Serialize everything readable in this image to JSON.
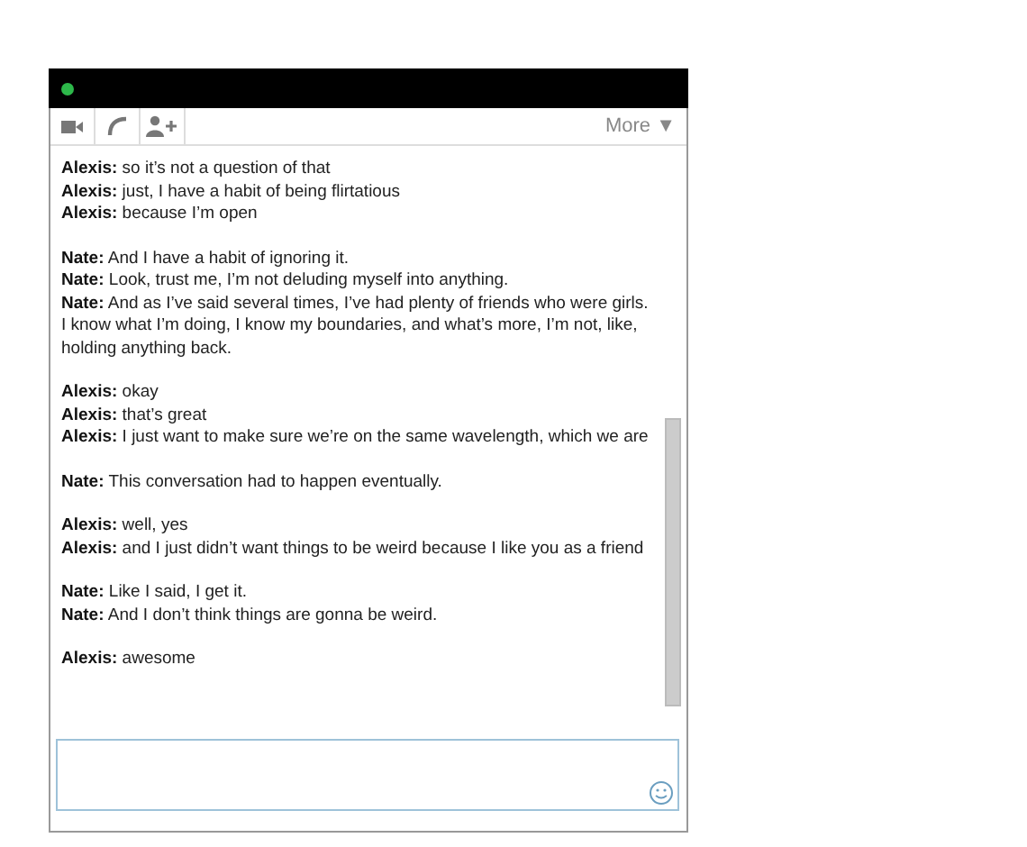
{
  "toolbar": {
    "more_label": "More ▼"
  },
  "conversation": [
    {
      "messages": [
        {
          "sender": "Alexis:",
          "text": "so it’s not a question of that"
        },
        {
          "sender": "Alexis:",
          "text": "just, I have a habit of being flirtatious"
        },
        {
          "sender": "Alexis:",
          "text": "because I’m open"
        }
      ]
    },
    {
      "messages": [
        {
          "sender": "Nate:",
          "text": "And I have a habit of ignoring it."
        },
        {
          "sender": "Nate:",
          "text": "Look, trust me, I’m not deluding myself into anything."
        },
        {
          "sender": "Nate:",
          "text": "And as I’ve said several times, I’ve had plenty of friends who were girls. I know what I’m doing, I know my boundaries, and what’s more, I’m not, like, holding anything back."
        }
      ]
    },
    {
      "messages": [
        {
          "sender": "Alexis:",
          "text": "okay"
        },
        {
          "sender": "Alexis:",
          "text": "that’s great"
        },
        {
          "sender": "Alexis:",
          "text": "I just want to make sure we’re on the same wavelength, which we are"
        }
      ]
    },
    {
      "messages": [
        {
          "sender": "Nate:",
          "text": "This conversation had to happen eventually."
        }
      ]
    },
    {
      "messages": [
        {
          "sender": "Alexis:",
          "text": "well, yes"
        },
        {
          "sender": "Alexis:",
          "text": "and I just didn’t want things to be weird because I like you as a friend"
        }
      ]
    },
    {
      "messages": [
        {
          "sender": "Nate:",
          "text": "Like I said, I get it."
        },
        {
          "sender": "Nate:",
          "text": "And I don’t think things are gonna be weird."
        }
      ]
    },
    {
      "messages": [
        {
          "sender": "Alexis:",
          "text": "awesome"
        }
      ]
    }
  ]
}
